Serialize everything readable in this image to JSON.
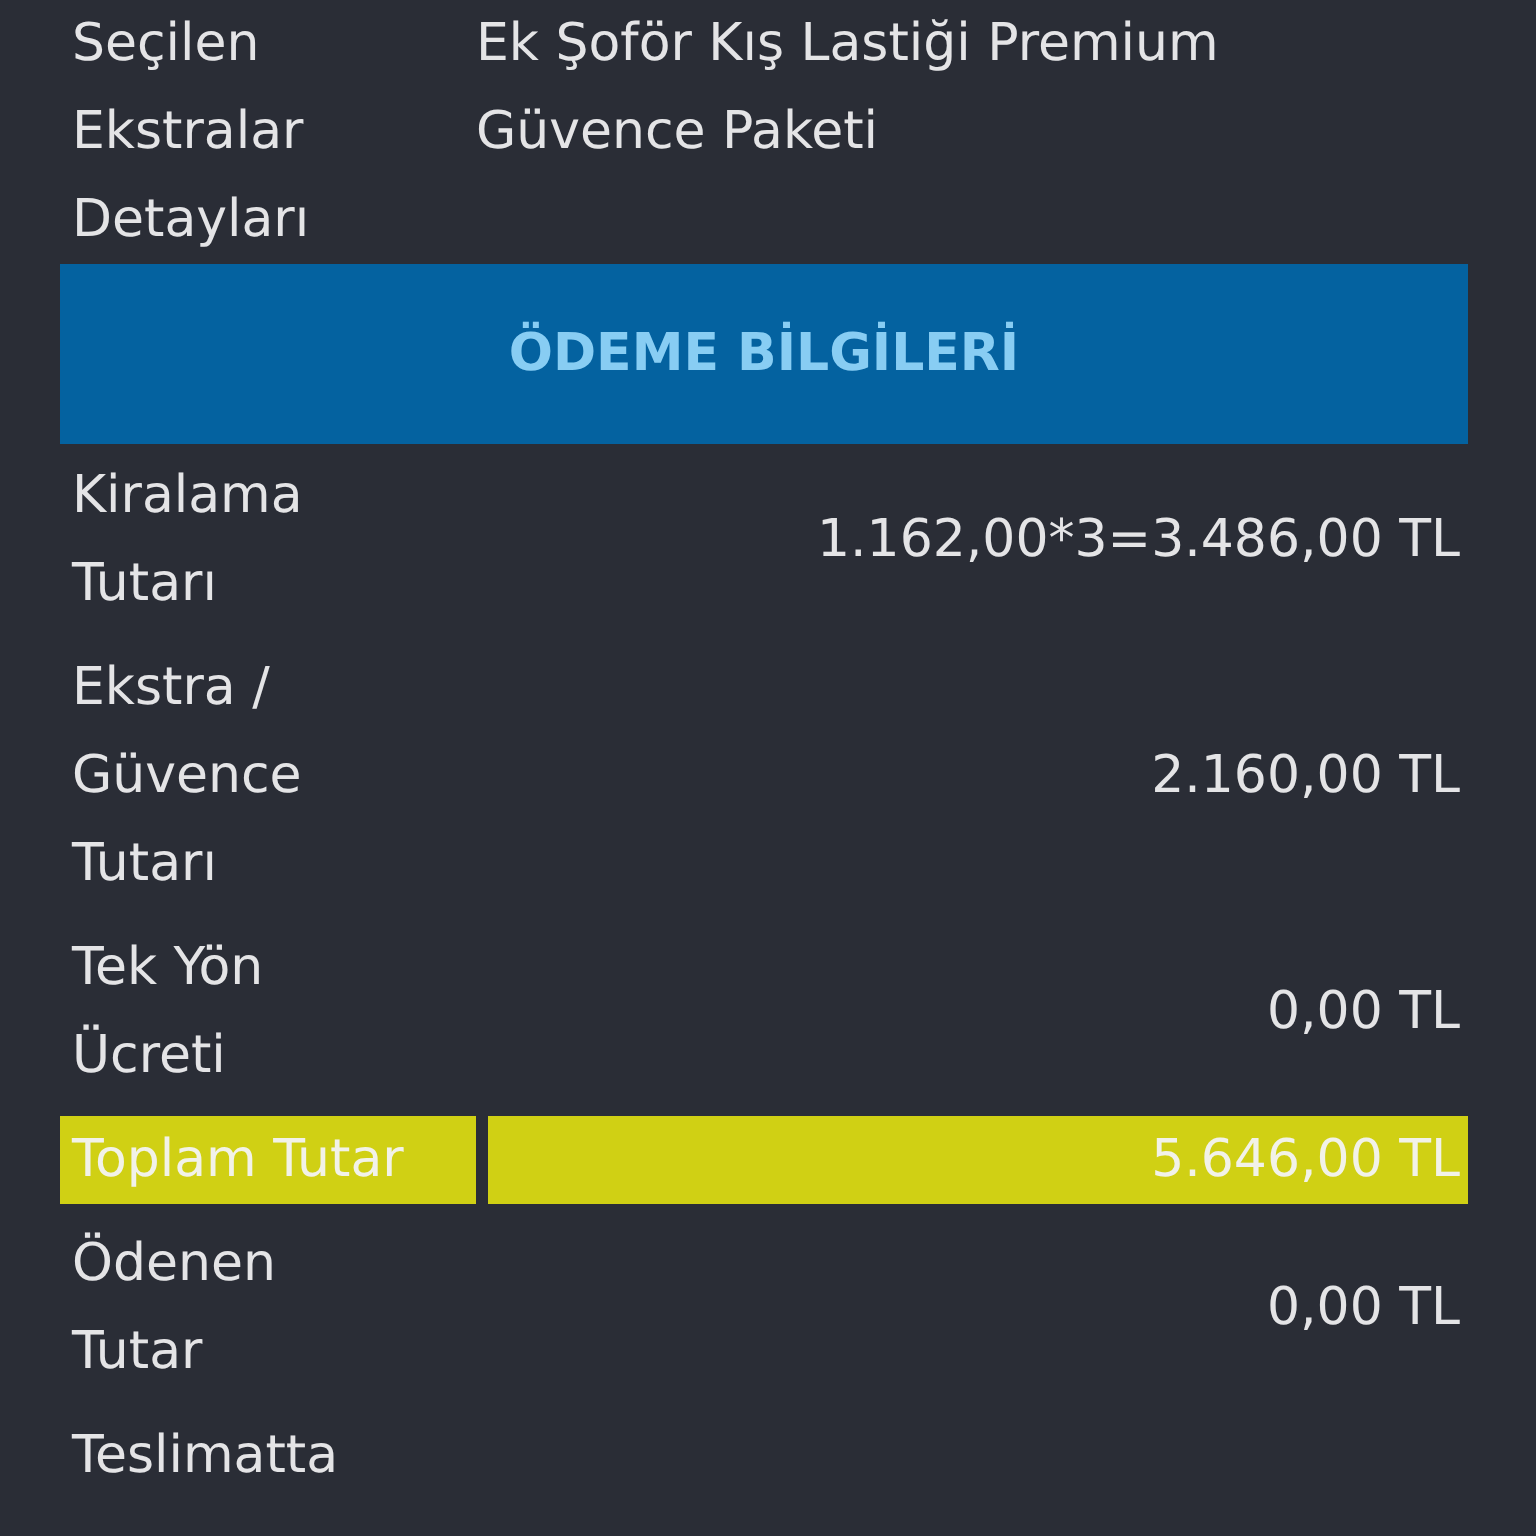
{
  "extras": {
    "label": "Seçilen\nEkstralar\nDetayları",
    "value": "Ek Şoför Kış Lastiği Premium\nGüvence Paketi"
  },
  "section_header": "ÖDEME BİLGİLERİ",
  "rows": [
    {
      "label": "Kiralama\nTutarı",
      "value": "1.162,00*3=3.486,00 TL",
      "highlighted": false
    },
    {
      "label": "Ekstra /\nGüvence\nTutarı",
      "value": "2.160,00 TL",
      "highlighted": false
    },
    {
      "label": "Tek Yön\nÜcreti",
      "value": "0,00 TL",
      "highlighted": false
    },
    {
      "label": "Toplam Tutar",
      "value": "5.646,00 TL",
      "highlighted": true
    },
    {
      "label": "Ödenen\nTutar",
      "value": "0,00 TL",
      "highlighted": false
    },
    {
      "label": "Teslimatta",
      "highlighted": false
    }
  ]
}
